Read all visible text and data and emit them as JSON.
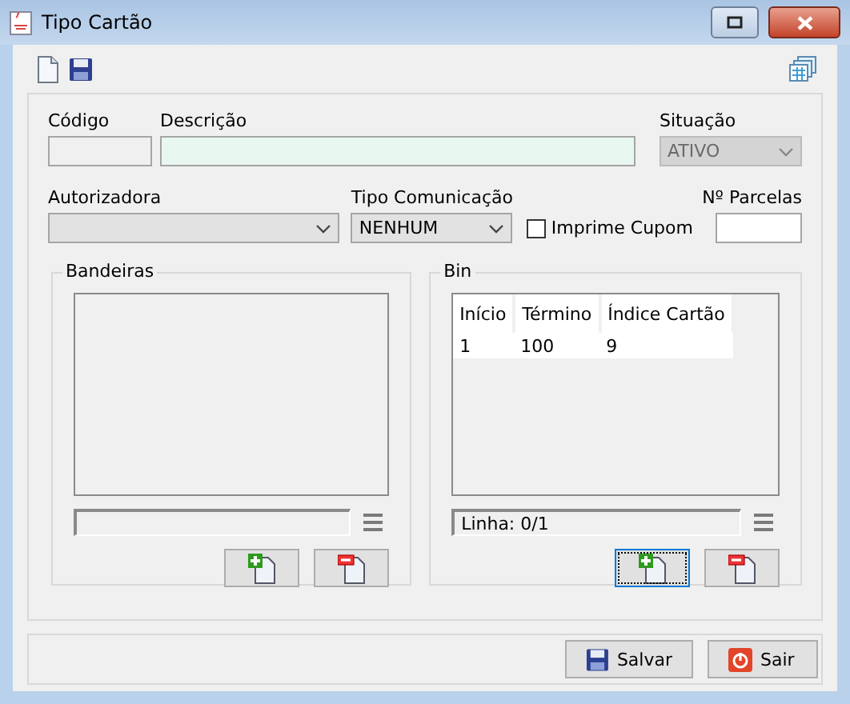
{
  "window": {
    "title": "Tipo Cartão"
  },
  "fields": {
    "codigo": {
      "label": "Código"
    },
    "descricao": {
      "label": "Descrição"
    },
    "situacao": {
      "label": "Situação",
      "value": "ATIVO",
      "disabled": true
    },
    "autorizadora": {
      "label": "Autorizadora"
    },
    "tipo_comunicacao": {
      "label": "Tipo Comunicação",
      "value": "NENHUM"
    },
    "imprime_cupom": {
      "label": "Imprime Cupom",
      "checked": false
    },
    "parcelas": {
      "label": "Nº Parcelas"
    }
  },
  "bandeiras": {
    "title": "Bandeiras",
    "buttons": [
      {
        "kind": "add",
        "focused": false
      },
      {
        "kind": "remove",
        "focused": false
      }
    ]
  },
  "bin": {
    "title": "Bin",
    "columns": [
      "Início",
      "Término",
      "Índice Cartão"
    ],
    "rows": [
      [
        "1",
        "100",
        "9"
      ]
    ],
    "status": "Linha: 0/1",
    "buttons": [
      {
        "kind": "add",
        "focused": true
      },
      {
        "kind": "remove",
        "focused": false
      }
    ]
  },
  "buttons": [
    {
      "kind": "save",
      "label": "Salvar"
    },
    {
      "kind": "exit",
      "label": "Sair"
    }
  ]
}
